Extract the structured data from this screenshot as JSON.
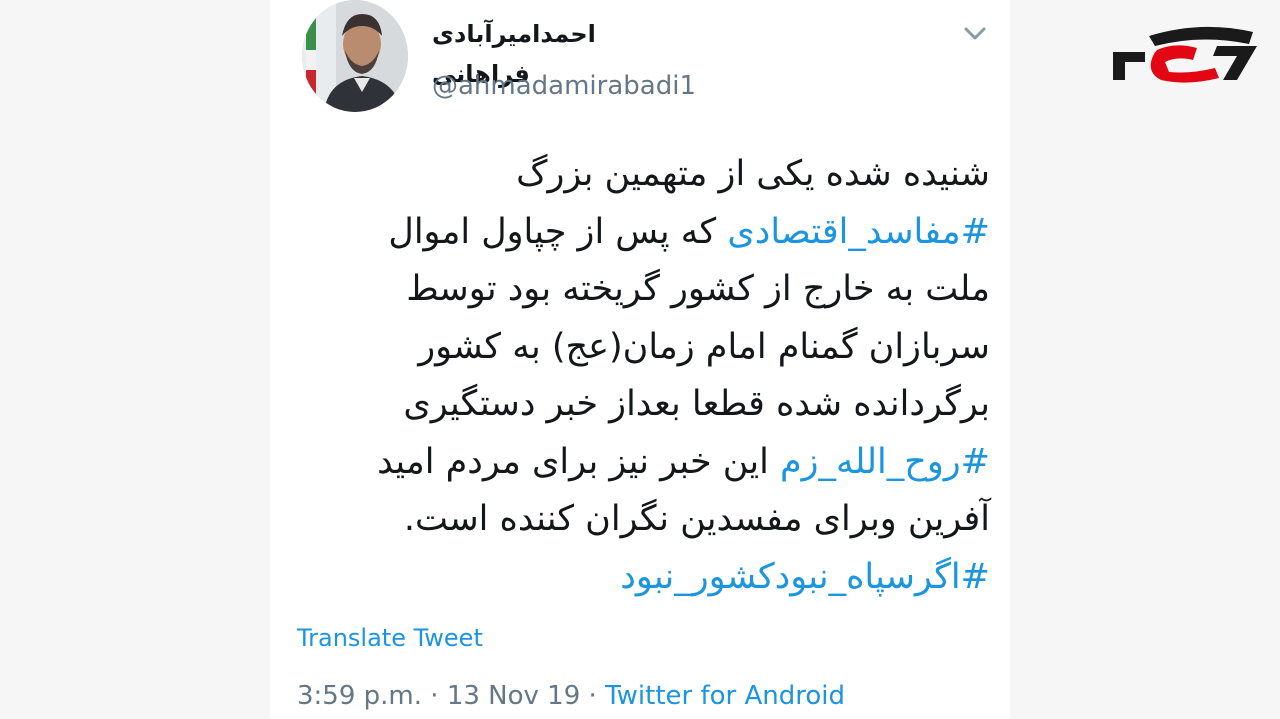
{
  "profile": {
    "display_name": "احمدامیرآبادی فراهانی",
    "handle": "@ahmadamirabadi1"
  },
  "tweet": {
    "lines": [
      [
        {
          "text": "شنیده شده یکی از متهمین بزرگ",
          "hashtag": false
        }
      ],
      [
        {
          "text": "#مفاسد_اقتصادی",
          "hashtag": true
        },
        {
          "text": " که پس از چپاول اموال",
          "hashtag": false
        }
      ],
      [
        {
          "text": "ملت به خارج از کشور گریخته بود توسط",
          "hashtag": false
        }
      ],
      [
        {
          "text": "سربازان گمنام امام زمان(عج) به کشور",
          "hashtag": false
        }
      ],
      [
        {
          "text": "برگردانده شده قطعا بعداز خبر دستگیری",
          "hashtag": false
        }
      ],
      [
        {
          "text": "#روح_الله_زم",
          "hashtag": true
        },
        {
          "text": " این خبر نیز برای مردم امید",
          "hashtag": false
        }
      ],
      [
        {
          "text": "آفرین وبرای مفسدین نگران کننده است.",
          "hashtag": false
        }
      ],
      [
        {
          "text": "#اگرسپاه_نبودکشور_نبود",
          "hashtag": true
        }
      ]
    ]
  },
  "translate_label": "Translate Tweet",
  "meta": {
    "time": "3:59 p.m.",
    "separator": " · ",
    "date": "13 Nov 19",
    "source": "Twitter for Android"
  },
  "icons": {
    "caret": "chevron-down-icon",
    "logo": "rokna-logo"
  },
  "colors": {
    "link": "#1b95e0",
    "muted": "#657786",
    "text": "#14171a",
    "logo_red": "#e30613",
    "logo_dark": "#1a1a1a"
  }
}
